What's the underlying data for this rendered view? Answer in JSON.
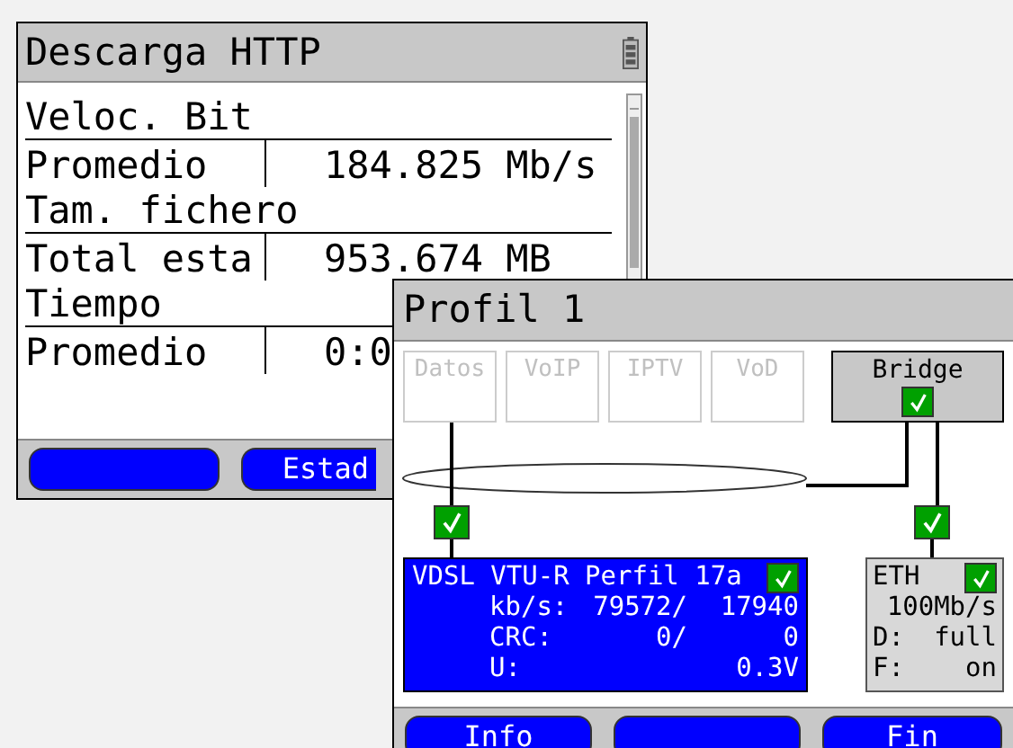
{
  "back_window": {
    "title": "Descarga HTTP",
    "rows": [
      {
        "kind": "header",
        "label": "Veloc. Bit"
      },
      {
        "kind": "value",
        "label": "Promedio",
        "value": "184.825 Mb/s"
      },
      {
        "kind": "header",
        "label": "Tam. fichero"
      },
      {
        "kind": "value",
        "label": "Total esta",
        "value": "953.674 MB"
      },
      {
        "kind": "header",
        "label": "Tiempo"
      },
      {
        "kind": "value",
        "label": "Promedio",
        "value": "0:0"
      }
    ],
    "buttons": [
      {
        "kind": "blank"
      },
      {
        "kind": "text",
        "label": "Estad"
      }
    ]
  },
  "front_window": {
    "title": "Profil 1",
    "services": [
      {
        "label": "Datos",
        "enabled": false
      },
      {
        "label": "VoIP",
        "enabled": false
      },
      {
        "label": "IPTV",
        "enabled": false
      },
      {
        "label": "VoD",
        "enabled": false
      }
    ],
    "bridge": {
      "label": "Bridge",
      "checked": true
    },
    "port_checks": [
      {
        "checked": true
      },
      {
        "checked": true
      }
    ],
    "vdsl": {
      "title": "VDSL VTU-R Perfil 17a",
      "checked": true,
      "rows": [
        {
          "label": "kb/s:",
          "values": [
            "79572/",
            "17940"
          ]
        },
        {
          "label": "CRC:",
          "values": [
            "0/",
            "0"
          ]
        },
        {
          "label": "U:",
          "values": [
            "0.3V"
          ]
        }
      ]
    },
    "eth": {
      "title": "ETH",
      "checked": true,
      "rows": [
        {
          "values": [
            "100Mb/s"
          ]
        },
        {
          "label": "D:",
          "values": [
            "full"
          ]
        },
        {
          "label": "F:",
          "values": [
            "on"
          ]
        }
      ]
    },
    "buttons": [
      {
        "kind": "text",
        "label": "Info"
      },
      {
        "kind": "blank"
      },
      {
        "kind": "text",
        "label": "Fin"
      }
    ]
  }
}
